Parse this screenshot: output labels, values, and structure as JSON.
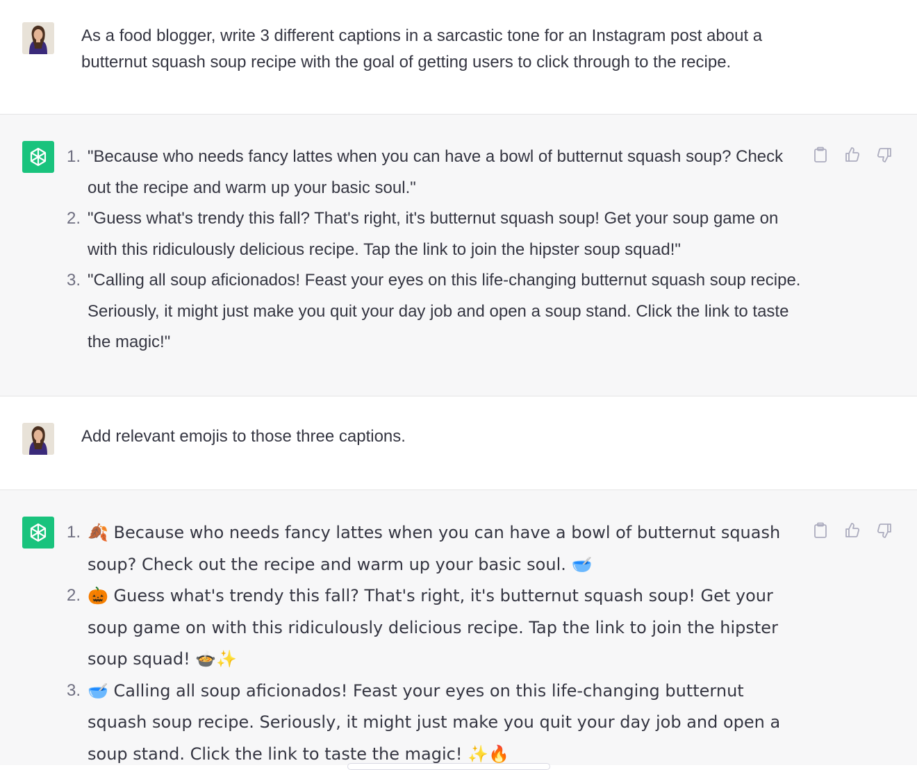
{
  "conversation": {
    "prompt1": "As a food blogger, write 3 different captions in a sarcastic tone for an Instagram post about a butternut squash soup recipe with the goal of getting users to click through to the recipe.",
    "answer1": [
      {
        "num": "1.",
        "text": "\"Because who needs fancy lattes when you can have a bowl of butternut squash soup? Check out the recipe and warm up your basic soul.\""
      },
      {
        "num": "2.",
        "text": "\"Guess what's trendy this fall? That's right, it's butternut squash soup! Get your soup game on with this ridiculously delicious recipe. Tap the link to join the hipster soup squad!\""
      },
      {
        "num": "3.",
        "text": "\"Calling all soup aficionados! Feast your eyes on this life-changing butternut squash soup recipe. Seriously, it might just make you quit your day job and open a soup stand. Click the link to taste the magic!\""
      }
    ],
    "prompt2": "Add relevant emojis to those three captions.",
    "answer2": [
      {
        "num": "1.",
        "text": "🍂 Because who needs fancy lattes when you can have a bowl of butternut squash soup? Check out the recipe and warm up your basic soul. 🥣"
      },
      {
        "num": "2.",
        "text": "🎃 Guess what's trendy this fall? That's right, it's butternut squash soup! Get your soup game on with this ridiculously delicious recipe. Tap the link to join the hipster soup squad! 🍲✨"
      },
      {
        "num": "3.",
        "text": "🥣 Calling all soup aficionados! Feast your eyes on this life-changing butternut squash soup recipe. Seriously, it might just make you quit your day job and open a soup stand. Click the link to taste the magic! ✨🔥"
      }
    ]
  },
  "icons": {
    "copy": "clipboard-icon",
    "like": "thumbs-up-icon",
    "dislike": "thumbs-down-icon",
    "assistant_avatar": "openai-logo-icon"
  },
  "colors": {
    "assistant_bg": "#f7f7f8",
    "bot_avatar": "#19c37d",
    "text": "#343541",
    "muted": "#6e6e80"
  }
}
